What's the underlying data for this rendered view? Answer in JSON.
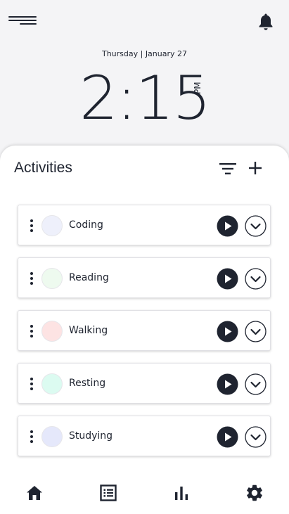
{
  "header": {
    "date": "Thursday |  January 27",
    "time": "2:15",
    "meridiem": "PM"
  },
  "activities_panel": {
    "title": "Activities",
    "items": [
      {
        "label": "Coding",
        "color": "#eef0fb"
      },
      {
        "label": "Reading",
        "color": "#eefaef"
      },
      {
        "label": "Walking",
        "color": "#fde3e3"
      },
      {
        "label": "Resting",
        "color": "#dcfbf1"
      },
      {
        "label": "Studying",
        "color": "#e5e8fb"
      }
    ]
  },
  "icons": {
    "menu": "menu-icon",
    "bell": "bell-icon",
    "filter": "filter-icon",
    "add": "plus-icon",
    "drag": "drag-dots-icon",
    "play": "play-icon",
    "expand": "chevron-down-icon",
    "home": "home-icon",
    "list": "list-icon",
    "stats": "bar-chart-icon",
    "settings": "gear-icon"
  },
  "colors": {
    "text": "#1f2430",
    "background": "#f4f4f6",
    "panel": "#ffffff"
  }
}
